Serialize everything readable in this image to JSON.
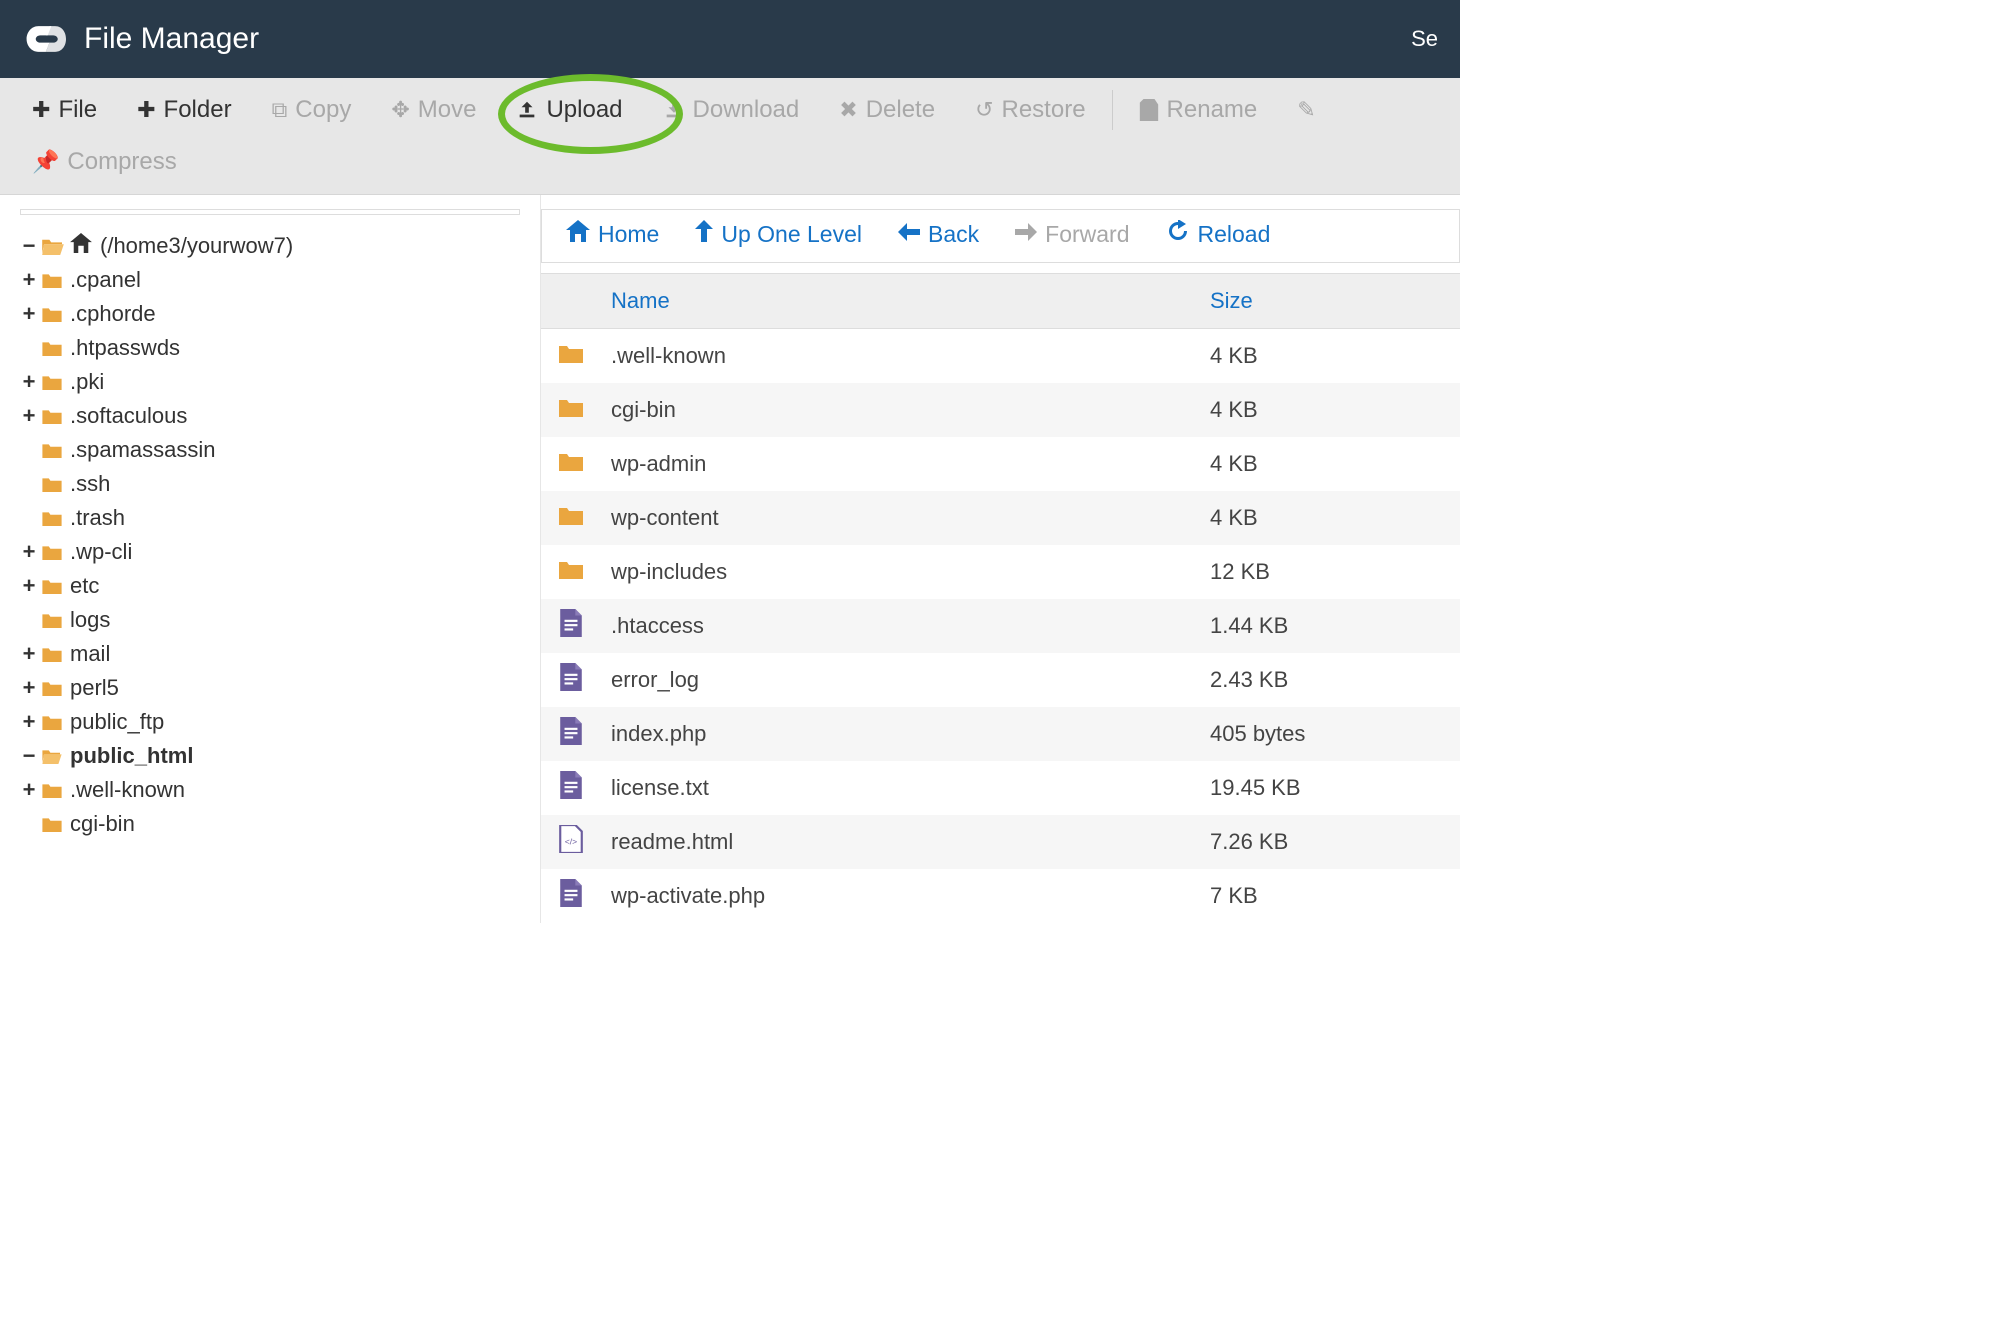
{
  "header": {
    "title": "File Manager",
    "right": "Se"
  },
  "toolbar": {
    "file": "File",
    "folder": "Folder",
    "copy": "Copy",
    "move": "Move",
    "upload": "Upload",
    "download": "Download",
    "delete": "Delete",
    "restore": "Restore",
    "rename": "Rename",
    "compress": "Compress"
  },
  "tree": {
    "root": "(/home3/yourwow7)",
    "items": [
      {
        "exp": "+",
        "label": ".cpanel",
        "indent": 1
      },
      {
        "exp": "+",
        "label": ".cphorde",
        "indent": 1
      },
      {
        "exp": "",
        "label": ".htpasswds",
        "indent": 1
      },
      {
        "exp": "+",
        "label": ".pki",
        "indent": 1
      },
      {
        "exp": "+",
        "label": ".softaculous",
        "indent": 1
      },
      {
        "exp": "",
        "label": ".spamassassin",
        "indent": 1
      },
      {
        "exp": "",
        "label": ".ssh",
        "indent": 1
      },
      {
        "exp": "",
        "label": ".trash",
        "indent": 1
      },
      {
        "exp": "+",
        "label": ".wp-cli",
        "indent": 1
      },
      {
        "exp": "+",
        "label": "etc",
        "indent": 1
      },
      {
        "exp": "",
        "label": "logs",
        "indent": 1
      },
      {
        "exp": "+",
        "label": "mail",
        "indent": 1
      },
      {
        "exp": "+",
        "label": "perl5",
        "indent": 1
      },
      {
        "exp": "+",
        "label": "public_ftp",
        "indent": 1
      },
      {
        "exp": "-",
        "label": "public_html",
        "indent": 1,
        "bold": true,
        "open": true
      },
      {
        "exp": "+",
        "label": ".well-known",
        "indent": 2
      },
      {
        "exp": "",
        "label": "cgi-bin",
        "indent": 2
      }
    ]
  },
  "nav": {
    "home": "Home",
    "up": "Up One Level",
    "back": "Back",
    "forward": "Forward",
    "reload": "Reload"
  },
  "table": {
    "columns": {
      "name": "Name",
      "size": "Size"
    },
    "rows": [
      {
        "icon": "folder",
        "name": ".well-known",
        "size": "4 KB"
      },
      {
        "icon": "folder",
        "name": "cgi-bin",
        "size": "4 KB"
      },
      {
        "icon": "folder",
        "name": "wp-admin",
        "size": "4 KB"
      },
      {
        "icon": "folder",
        "name": "wp-content",
        "size": "4 KB"
      },
      {
        "icon": "folder",
        "name": "wp-includes",
        "size": "12 KB"
      },
      {
        "icon": "file",
        "name": ".htaccess",
        "size": "1.44 KB"
      },
      {
        "icon": "file",
        "name": "error_log",
        "size": "2.43 KB"
      },
      {
        "icon": "file",
        "name": "index.php",
        "size": "405 bytes"
      },
      {
        "icon": "file",
        "name": "license.txt",
        "size": "19.45 KB"
      },
      {
        "icon": "html",
        "name": "readme.html",
        "size": "7.26 KB"
      },
      {
        "icon": "file",
        "name": "wp-activate.php",
        "size": "7 KB"
      }
    ]
  }
}
